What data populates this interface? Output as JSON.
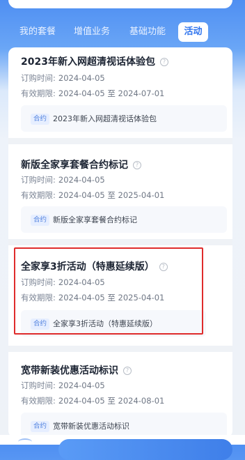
{
  "tabs": [
    {
      "label": "我的套餐",
      "active": false
    },
    {
      "label": "增值业务",
      "active": false
    },
    {
      "label": "基础功能",
      "active": false
    },
    {
      "label": "活动",
      "active": true
    }
  ],
  "plans": [
    {
      "title": "2023年新入网超清视话体验包",
      "order_label": "订购时间:",
      "order_date": "2024-04-05",
      "valid_label": "有效期限:",
      "valid_range": "2024-04-05 至 2024-07-01",
      "contract_tag": "合约",
      "contract_name": "2023年新入网超清视话体验包"
    },
    {
      "title": "新版全家享套餐合约标记",
      "order_label": "订购时间:",
      "order_date": "2024-04-05",
      "valid_label": "有效期限:",
      "valid_range": "2024-04-05 至 2025-04-01",
      "contract_tag": "合约",
      "contract_name": "新版全家享套餐合约标记"
    },
    {
      "title": "全家享3折活动（特惠延续版）",
      "order_label": "订购时间:",
      "order_date": "2024-04-05",
      "valid_label": "有效期限:",
      "valid_range": "2024-04-05 至 2025-04-01",
      "contract_tag": "合约",
      "contract_name": "全家享3折活动（特惠延续版）",
      "highlighted": true
    },
    {
      "title": "宽带新装优惠活动标识",
      "order_label": "订购时间:",
      "order_date": "2024-04-05",
      "valid_label": "有效期限:",
      "valid_range": "2024-04-05 至 2024-08-01",
      "contract_tag": "合约",
      "contract_name": "宽带新装优惠活动标识"
    }
  ],
  "icons": {
    "help": "question-circle-icon"
  },
  "colors": {
    "accent": "#2f74ee",
    "highlight": "#df2b2b",
    "tag_bg": "#e6eeff"
  }
}
